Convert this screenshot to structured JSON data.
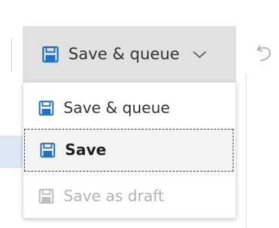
{
  "toolbar": {
    "save_queue_label": "Save & queue",
    "save_icon": "save-icon",
    "chevron_icon": "chevron-down-icon",
    "undo_icon": "undo-icon"
  },
  "menu": {
    "items": [
      {
        "label": "Save & queue",
        "icon": "save-icon",
        "state": "normal"
      },
      {
        "label": "Save",
        "icon": "save-icon",
        "state": "focused"
      },
      {
        "label": "Save as draft",
        "icon": "save-icon",
        "state": "disabled"
      }
    ]
  },
  "colors": {
    "accent": "#1e73c9",
    "toolbar_bg": "#e1e1e1",
    "disabled_text": "#b4b4b4",
    "selected_row_bg": "#dbe7f3"
  }
}
